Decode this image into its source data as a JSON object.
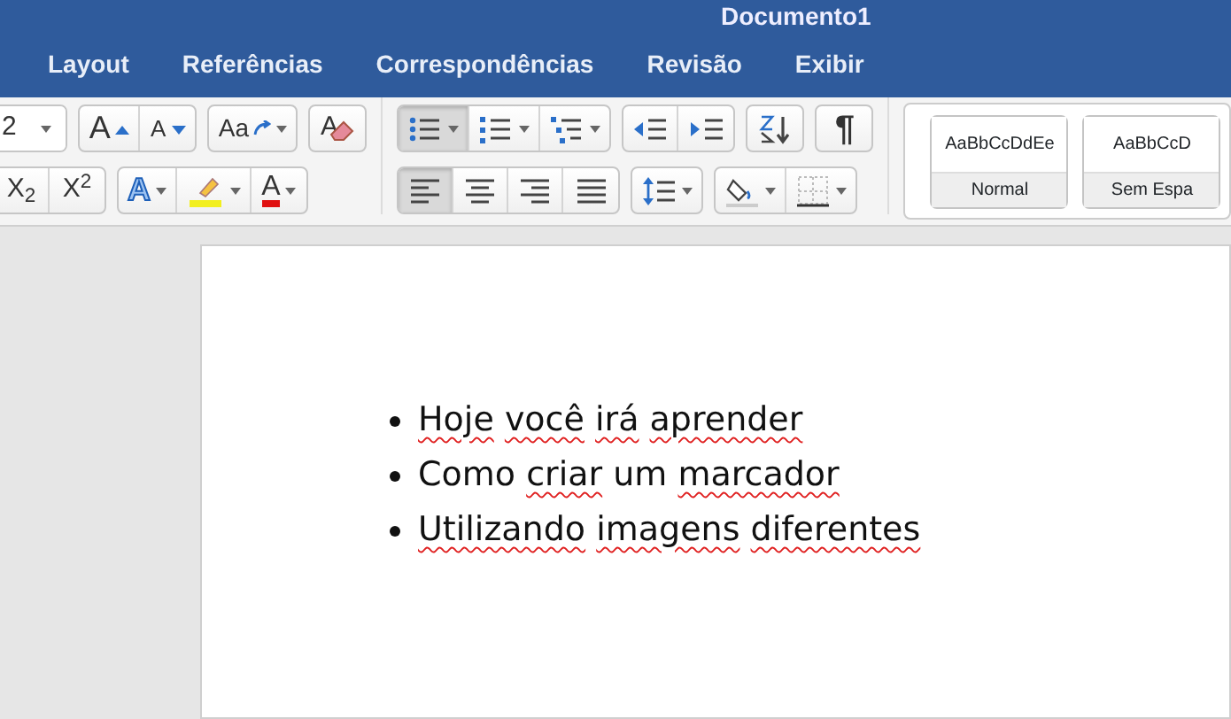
{
  "window": {
    "title": "Documento1"
  },
  "tabs": [
    {
      "label": "Layout"
    },
    {
      "label": "Referências"
    },
    {
      "label": "Correspondências"
    },
    {
      "label": "Revisão"
    },
    {
      "label": "Exibir"
    }
  ],
  "ribbon": [
    {
      "row1": [
        [
          {
            "kind": "field",
            "value": "2",
            "dropdown": true
          }
        ],
        [
          {
            "kind": "grow",
            "label": "A"
          },
          {
            "kind": "shrink",
            "label": "A"
          }
        ],
        [
          {
            "kind": "case",
            "label": "Aa",
            "dropdown": true
          }
        ],
        [
          {
            "kind": "clear",
            "label": "A"
          }
        ]
      ],
      "row2": [
        [
          {
            "kind": "sub",
            "label": "X$_{2}$"
          },
          {
            "kind": "sup",
            "label": "X$^{2}$"
          }
        ],
        [
          {
            "kind": "effects",
            "label": "A",
            "dropdown": true
          },
          {
            "kind": "highlight",
            "dropdown": true
          },
          {
            "kind": "fontcolor",
            "label": "A",
            "dropdown": true
          }
        ]
      ]
    },
    {
      "row1": [
        [
          {
            "kind": "bullets",
            "selected": true,
            "dropdown": true
          },
          {
            "kind": "numbering",
            "selected": false,
            "dropdown": true
          },
          {
            "kind": "multilevel",
            "selected": false,
            "dropdown": true
          }
        ],
        [
          {
            "kind": "outdent"
          },
          {
            "kind": "indent"
          }
        ],
        [
          {
            "kind": "sort"
          }
        ],
        [
          {
            "kind": "pilcrow",
            "label": "¶"
          }
        ]
      ],
      "row2": [
        [
          {
            "kind": "align-left",
            "selected": true
          },
          {
            "kind": "align-center",
            "selected": false
          },
          {
            "kind": "align-right",
            "selected": false
          },
          {
            "kind": "justify",
            "selected": false
          }
        ],
        [
          {
            "kind": "spacing",
            "dropdown": true
          }
        ],
        [
          {
            "kind": "shading",
            "dropdown": true
          },
          {
            "kind": "borders",
            "dropdown": true
          }
        ]
      ]
    }
  ],
  "styles": [
    {
      "preview": "AaBbCcDdEe",
      "name": "Normal"
    },
    {
      "preview": "AaBbCcD",
      "name": "Sem Espa"
    }
  ],
  "document": {
    "bullets": [
      {
        "segments": [
          {
            "text": "Hoje",
            "flagged": true
          },
          {
            "text": "você",
            "flagged": true
          },
          {
            "text": "irá",
            "flagged": true
          },
          {
            "text": "aprender",
            "flagged": true
          }
        ]
      },
      {
        "segments": [
          {
            "text": "Como",
            "flagged": false
          },
          {
            "text": "criar",
            "flagged": true
          },
          {
            "text": "um",
            "flagged": false
          },
          {
            "text": "marcador",
            "flagged": true
          }
        ]
      },
      {
        "segments": [
          {
            "text": "Utilizando",
            "flagged": true
          },
          {
            "text": "imagens",
            "flagged": true
          },
          {
            "text": "diferentes",
            "flagged": true
          }
        ]
      }
    ]
  }
}
